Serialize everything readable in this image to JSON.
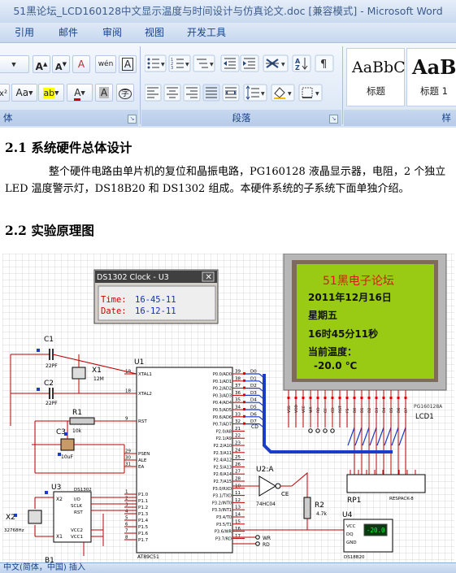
{
  "window": {
    "title": "51黑论坛_LCD160128中文显示温度与时间设计与仿真论文.doc [兼容模式] - Microsoft Word"
  },
  "ribbon": {
    "tabs": [
      "引用",
      "邮件",
      "审阅",
      "视图",
      "开发工具"
    ],
    "groups": {
      "font_partial": "体",
      "paragraph": "段落",
      "styles_partial": "样"
    },
    "font_buttons": {
      "grow": "A",
      "shrink": "A",
      "clear": "A",
      "phonetic": "wén",
      "border": "A",
      "change_case": "Aa",
      "highlight": "ab",
      "font_color": "A",
      "char_shading": "A",
      "x2": "x²"
    },
    "styles": [
      {
        "sample": "AaBbC",
        "name": "标题"
      },
      {
        "sample": "AaB",
        "name": "标题 1"
      }
    ]
  },
  "document": {
    "heading_1": "2.1 系统硬件总体设计",
    "paragraph_1": "整个硬件电路由单片机的复位和晶振电路，PG160128 液晶显示器，电阻，2 个独立 LED 温度警示灯，DS18B20 和 DS1302 组成。本硬件系统的子系统下面单独介绍。",
    "heading_2": "2.2 实验原理图"
  },
  "schematic": {
    "ds1302_window": {
      "title": "DS1302 Clock - U3",
      "time_label": "Time:",
      "time_value": "16-45-11",
      "date_label": "Date:",
      "date_value": "16-12-11"
    },
    "lcd": {
      "line1": "51黑电子论坛",
      "line2": "2011年12月16日",
      "line3": "星期五",
      "line4": "16时45分11秒",
      "line5": "当前温度：",
      "line6": "-20.0 ℃",
      "part": "PG160128A",
      "ref": "LCD1"
    },
    "mcu": {
      "ref": "U1",
      "part": "AT89C51",
      "left_pins": [
        {
          "num": "19",
          "name": "XTAL1"
        },
        {
          "num": "18",
          "name": "XTAL2"
        },
        {
          "num": "9",
          "name": "RST"
        },
        {
          "num": "29",
          "name": "PSEN"
        },
        {
          "num": "30",
          "name": "ALE"
        },
        {
          "num": "31",
          "name": "EA"
        },
        {
          "num": "1",
          "name": "P1.0"
        },
        {
          "num": "2",
          "name": "P1.1"
        },
        {
          "num": "3",
          "name": "P1.2"
        },
        {
          "num": "4",
          "name": "P1.3"
        },
        {
          "num": "5",
          "name": "P1.4"
        },
        {
          "num": "6",
          "name": "P1.5"
        },
        {
          "num": "7",
          "name": "P1.6"
        },
        {
          "num": "8",
          "name": "P1.7"
        }
      ],
      "right_pins": [
        {
          "num": "39",
          "name": "P0.0/AD0"
        },
        {
          "num": "38",
          "name": "P0.1/AD1"
        },
        {
          "num": "37",
          "name": "P0.2/AD2"
        },
        {
          "num": "36",
          "name": "P0.3/AD3"
        },
        {
          "num": "35",
          "name": "P0.4/AD4"
        },
        {
          "num": "34",
          "name": "P0.5/AD5"
        },
        {
          "num": "33",
          "name": "P0.6/AD6"
        },
        {
          "num": "32",
          "name": "P0.7/AD7"
        },
        {
          "num": "21",
          "name": "P2.0/A8"
        },
        {
          "num": "22",
          "name": "P2.1/A9"
        },
        {
          "num": "23",
          "name": "P2.2/A10"
        },
        {
          "num": "24",
          "name": "P2.3/A11"
        },
        {
          "num": "25",
          "name": "P2.4/A12"
        },
        {
          "num": "26",
          "name": "P2.5/A13"
        },
        {
          "num": "27",
          "name": "P2.6/A14"
        },
        {
          "num": "28",
          "name": "P2.7/A15"
        },
        {
          "num": "10",
          "name": "P3.0/RXD"
        },
        {
          "num": "11",
          "name": "P3.1/TXD"
        },
        {
          "num": "12",
          "name": "P3.2/INT0"
        },
        {
          "num": "13",
          "name": "P3.3/INT1"
        },
        {
          "num": "14",
          "name": "P3.4/T0"
        },
        {
          "num": "15",
          "name": "P3.5/T1"
        },
        {
          "num": "16",
          "name": "P3.6/WR"
        },
        {
          "num": "17",
          "name": "P3.7/RD"
        }
      ]
    },
    "parts": {
      "c1": "C1",
      "c1_val": "22PF",
      "c2": "C2",
      "c2_val": "22PF",
      "c3": "C3",
      "c3_val": "10uF",
      "x1": "X1",
      "x1_val": "12M",
      "r1": "R1",
      "r1_val": "10k",
      "u2": "U2:A",
      "u2_part": "74HC04",
      "r2": "R2",
      "r2_val": "4.7k",
      "ce": "CE",
      "cd": "CD",
      "rp1": "RP1",
      "rp1_part": "RESPACK-8",
      "u3": "U3",
      "u3_part": "DS1302",
      "u3_pins_left": [
        "X2",
        "X1"
      ],
      "u3_pins_right": [
        "I/O",
        "SCLK",
        "RST",
        "VCC2",
        "VCC1"
      ],
      "x2": "X2",
      "x2_val": "32768Hz",
      "b1": "B1",
      "u4": "U4",
      "u4_part": "DS18B20",
      "u4_display": "-20.0",
      "u4_pins": [
        "VCC",
        "DQ",
        "GND"
      ],
      "wr": "WR",
      "rd": "RD",
      "d_labels": [
        "D0",
        "D1",
        "D2",
        "D3",
        "D4",
        "D5",
        "D6",
        "D7"
      ],
      "lcd_pins": [
        "VSS",
        "VDD",
        "VEE",
        "WR",
        "RD",
        "CE",
        "CD",
        "RST",
        "FS",
        "D0",
        "D1",
        "D2",
        "D3",
        "D4",
        "D5",
        "D6",
        "D7"
      ]
    }
  },
  "statusbar": {
    "text": "中文(简体，中国)    插入"
  }
}
